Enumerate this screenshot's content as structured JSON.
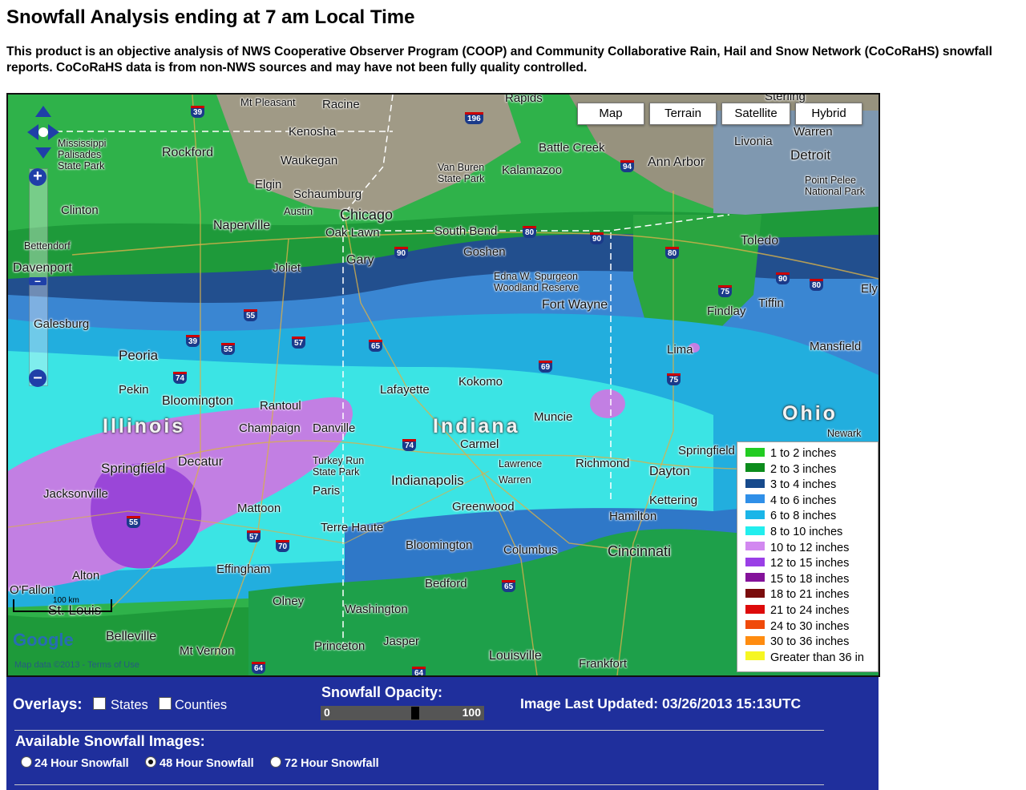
{
  "page": {
    "title": "Snowfall Analysis ending at 7 am Local Time",
    "description": "This product is an objective analysis of NWS Cooperative Observer Program (COOP) and Community Collaborative Rain, Hail and Snow Network (CoCoRaHS) snowfall reports.  CoCoRaHS data is from non-NWS sources and may have not been fully quality controlled."
  },
  "map": {
    "type_buttons": [
      "Map",
      "Terrain",
      "Satellite",
      "Hybrid"
    ],
    "scale_label": "100 km",
    "google_logo": "Google",
    "terms": "Map data ©2013 - Terms of Use",
    "states": [
      "Illinois",
      "Indiana",
      "Ohio"
    ],
    "cities": [
      "Mt Pleasant",
      "Racine",
      "Kenosha",
      "Waukegan",
      "Rockford",
      "Elgin",
      "Schaumburg",
      "Austin",
      "Chicago",
      "Naperville",
      "Oak Lawn",
      "Joliet",
      "Gary",
      "Clinton",
      "Bettendorf",
      "Davenport",
      "Galesburg",
      "Peoria",
      "Pekin",
      "Bloomington",
      "Rantoul",
      "Champaign",
      "Danville",
      "Springfield",
      "Decatur",
      "Jacksonville",
      "Mattoon",
      "Effingham",
      "Alton",
      "O'Fallon",
      "St. Louis",
      "Belleville",
      "Olney",
      "Mt Vernon",
      "Rapids",
      "Battle Creek",
      "Kalamazoo",
      "Ann Arbor",
      "Livonia",
      "Detroit",
      "Warren",
      "Toledo",
      "South Bend",
      "Goshen",
      "Fort Wayne",
      "Findlay",
      "Tiffin",
      "Lima",
      "Mansfield",
      "Lafayette",
      "Kokomo",
      "Muncie",
      "Carmel",
      "Lawrence",
      "Indianapolis",
      "Warren",
      "Richmond",
      "Dayton",
      "Springfield",
      "Kettering",
      "Newark",
      "Hamilton",
      "Cincinnati",
      "Greenwood",
      "Columbus",
      "Terre Haute",
      "Paris",
      "Bloomington",
      "Bedford",
      "Washington",
      "Jasper",
      "Princeton",
      "Louisville",
      "Frankfort",
      "Sterling",
      "Ely"
    ],
    "parks": [
      "Mississippi Palisades State Park",
      "Van Buren State Park",
      "Point Pelee National Park",
      "Edna W. Spurgeon Woodland Reserve",
      "Turkey Run State Park"
    ],
    "highways": [
      "39",
      "196",
      "94",
      "80",
      "90",
      "90",
      "80",
      "90",
      "80",
      "75",
      "55",
      "55",
      "39",
      "57",
      "65",
      "69",
      "74",
      "75",
      "74",
      "55",
      "57",
      "70",
      "65",
      "64",
      "64"
    ]
  },
  "legend": [
    {
      "label": "1 to 2 inches",
      "color": "#22cc22"
    },
    {
      "label": "2 to 3 inches",
      "color": "#0c8c1c"
    },
    {
      "label": "3 to 4 inches",
      "color": "#174a8c"
    },
    {
      "label": "4 to 6 inches",
      "color": "#2f8fe8"
    },
    {
      "label": "6 to 8 inches",
      "color": "#1ab5e8"
    },
    {
      "label": "8 to 10 inches",
      "color": "#22eeee"
    },
    {
      "label": "10 to 12 inches",
      "color": "#d288f0"
    },
    {
      "label": "12 to 15 inches",
      "color": "#9a3fe6"
    },
    {
      "label": "15 to 18 inches",
      "color": "#84129a"
    },
    {
      "label": "18 to 21 inches",
      "color": "#7a0c0c"
    },
    {
      "label": "21 to 24 inches",
      "color": "#dd0a0a"
    },
    {
      "label": "24 to 30 inches",
      "color": "#f04a0a"
    },
    {
      "label": "30 to 36 inches",
      "color": "#ff8c10"
    },
    {
      "label": "Greater than 36 in",
      "color": "#f6f622"
    }
  ],
  "controls": {
    "overlays_label": "Overlays:",
    "states_label": "States",
    "counties_label": "Counties",
    "opacity_label": "Snowfall Opacity:",
    "opacity_min": "0",
    "opacity_max": "100",
    "opacity_value": 58,
    "updated_label": "Image Last Updated: 03/26/2013 15:13UTC",
    "available_label": "Available Snowfall Images:",
    "images": [
      {
        "label": "24 Hour Snowfall",
        "selected": false
      },
      {
        "label": "48 Hour Snowfall",
        "selected": true
      },
      {
        "label": "72 Hour Snowfall",
        "selected": false
      }
    ]
  }
}
